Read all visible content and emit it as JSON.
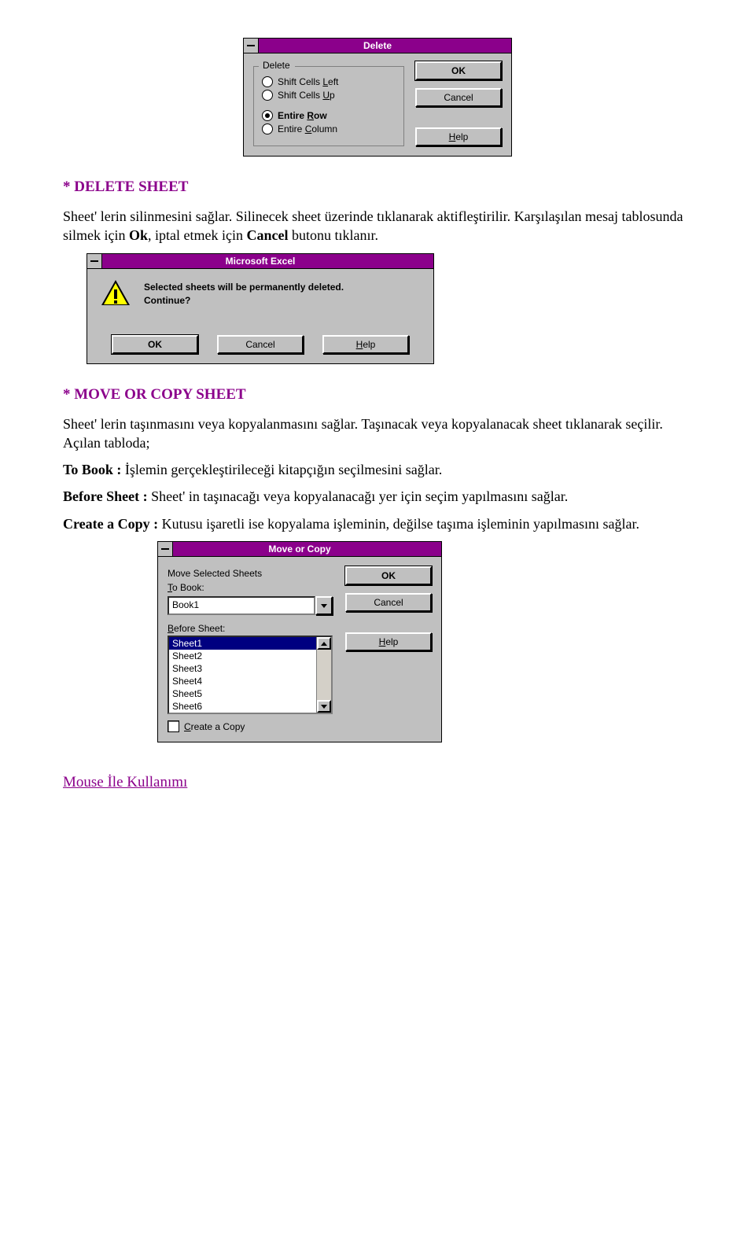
{
  "dialogs": {
    "delete": {
      "title": "Delete",
      "group_title": "Delete",
      "options": {
        "shift_left": "Shift Cells Left",
        "shift_up": "Shift Cells Up",
        "entire_row": "Entire Row",
        "entire_column": "Entire Column"
      },
      "buttons": {
        "ok": "OK",
        "cancel": "Cancel",
        "help": "Help"
      }
    },
    "msg": {
      "title": "Microsoft Excel",
      "line1": "Selected sheets will be permanently deleted.",
      "line2": "Continue?",
      "buttons": {
        "ok": "OK",
        "cancel": "Cancel",
        "help": "Help"
      }
    },
    "move_copy": {
      "title": "Move or Copy",
      "heading": "Move Selected Sheets",
      "to_book_label": "To Book:",
      "to_book_value": "Book1",
      "before_sheet_label": "Before Sheet:",
      "sheets": [
        "Sheet1",
        "Sheet2",
        "Sheet3",
        "Sheet4",
        "Sheet5",
        "Sheet6"
      ],
      "create_copy_label": "Create a Copy",
      "buttons": {
        "ok": "OK",
        "cancel": "Cancel",
        "help": "Help"
      }
    }
  },
  "doc": {
    "h_delete_sheet": "* DELETE SHEET",
    "p_delete_sheet": "Sheet' lerin silinmesini sağlar. Silinecek sheet üzerinde tıklanarak aktifleştirilir. Karşılaşılan mesaj tablosunda silmek için Ok, iptal etmek için Cancel butonu tıklanır.",
    "h_move_copy": "* MOVE OR COPY SHEET",
    "p_move_copy_1": "Sheet' lerin taşınmasını veya kopyalanmasını sağlar. Taşınacak veya kopyalanacak sheet tıklanarak seçilir. Açılan tabloda;",
    "to_book_label": "To Book :",
    "to_book_text": " İşlemin gerçekleştirileceği kitapçığın seçilmesini sağlar.",
    "before_sheet_label": "Before Sheet :",
    "before_sheet_text": " Sheet' in taşınacağı veya kopyalanacağı yer için seçim yapılmasını sağlar.",
    "create_copy_label": "Create a Copy :",
    "create_copy_text": " Kutusu işaretli ise kopyalama işleminin, değilse taşıma işleminin yapılmasını sağlar.",
    "mouse_heading": "Mouse İle Kullanımı"
  }
}
